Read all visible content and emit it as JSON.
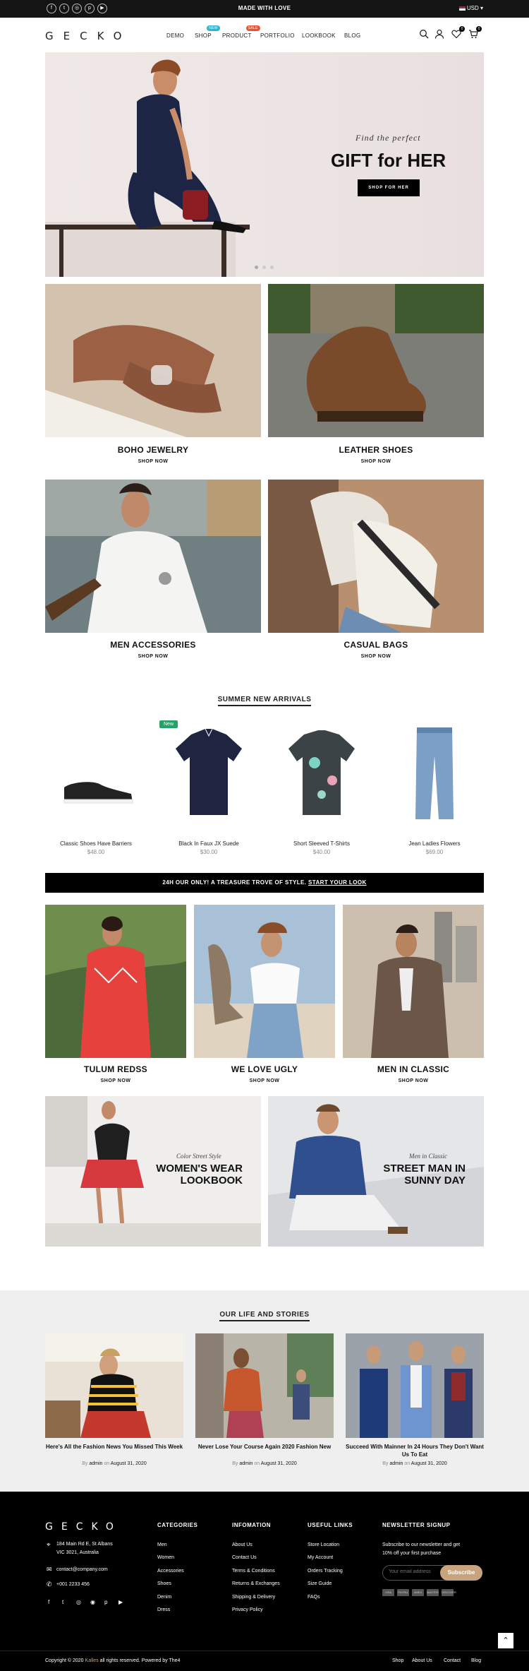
{
  "topbar": {
    "social_icons": [
      "facebook-icon",
      "twitter-icon",
      "instagram-icon",
      "pinterest-icon",
      "youtube-icon"
    ],
    "message": "MADE WITH LOVE",
    "currency": "USD"
  },
  "header": {
    "logo": "GECKO",
    "nav": [
      {
        "label": "DEMO"
      },
      {
        "label": "SHOP",
        "badge": "NEW",
        "badge_color": "#2fb5d2"
      },
      {
        "label": "PRODUCT",
        "badge": "SALE",
        "badge_color": "#e8563a"
      },
      {
        "label": "PORTFOLIO"
      },
      {
        "label": "LOOKBOOK"
      },
      {
        "label": "BLOG"
      }
    ],
    "wishlist_count": "0",
    "cart_count": "0"
  },
  "hero": {
    "subtitle": "Find the perfect",
    "title": "GIFT for HER",
    "button": "SHOP FOR HER",
    "slides": 3
  },
  "categories": [
    {
      "title": "BOHO JEWELRY",
      "link": "SHOP NOW"
    },
    {
      "title": "LEATHER SHOES",
      "link": "SHOP NOW"
    },
    {
      "title": "MEN ACCESSORIES",
      "link": "SHOP NOW"
    },
    {
      "title": "CASUAL BAGS",
      "link": "SHOP NOW"
    }
  ],
  "arrivals": {
    "title": "SUMMER NEW ARRIVALS",
    "products": [
      {
        "name": "Classic Shoes Have Barriers",
        "price": "$48.00"
      },
      {
        "name": "Black In Faux JX Suede",
        "price": "$30.00",
        "badge": "New"
      },
      {
        "name": "Short Sleeved T-Shirts",
        "price": "$40.00"
      },
      {
        "name": "Jean Ladies Flowers",
        "price": "$69.00"
      }
    ]
  },
  "promo": {
    "text": "24H OUR ONLY! A TREASURE TROVE OF STYLE.",
    "link": "START YOUR LOOK"
  },
  "collections": [
    {
      "title": "TULUM REDSS",
      "link": "SHOP NOW"
    },
    {
      "title": "WE LOVE UGLY",
      "link": "SHOP NOW"
    },
    {
      "title": "MEN IN CLASSIC",
      "link": "SHOP NOW"
    }
  ],
  "banners": [
    {
      "subtitle": "Color Street Style",
      "title_line1": "WOMEN'S WEAR",
      "title_line2": "LOOKBOOK"
    },
    {
      "subtitle": "Men in Classic",
      "title_line1": "STREET MAN IN",
      "title_line2": "SUNNY DAY"
    }
  ],
  "stories": {
    "title": "OUR LIFE AND STORIES",
    "posts": [
      {
        "title": "Here's All the Fashion News You Missed This Week",
        "by": "By",
        "author": "admin",
        "on": "on",
        "date": "August 31, 2020"
      },
      {
        "title": "Never Lose Your Course Again 2020 Fashion New",
        "by": "By",
        "author": "admin",
        "on": "on",
        "date": "August 31, 2020"
      },
      {
        "title": "Succeed With Mainner In 24 Hours They Don't Want Us To Eat",
        "by": "By",
        "author": "admin",
        "on": "on",
        "date": "August 31, 2020"
      }
    ]
  },
  "footer": {
    "logo": "GECKO",
    "address_line1": "184 Main Rd E, St Albans",
    "address_line2": "VIC 3021, Australia",
    "email": "contact@company.com",
    "phone": "+001 2233 456",
    "categories_title": "CATEGORIES",
    "categories": [
      "Men",
      "Women",
      "Accessories",
      "Shoes",
      "Denim",
      "Dress"
    ],
    "info_title": "INFOMATION",
    "info": [
      "About Us",
      "Contact Us",
      "Terms & Conditions",
      "Returns & Exchanges",
      "Shipping & Delivery",
      "Privacy Policy"
    ],
    "useful_title": "USEFUL LINKS",
    "useful": [
      "Store Location",
      "My Account",
      "Orders Tracking",
      "Size Guide",
      "FAQs"
    ],
    "newsletter_title": "NEWSLETTER SIGNUP",
    "newsletter_text1": "Subscribe to our newsletter and get",
    "newsletter_text2": "10% off your first purchase",
    "email_placeholder": "Your email address",
    "subscribe": "Subscribe",
    "payments": [
      "VISA",
      "PAYPAL",
      "AMEX",
      "MASTER",
      "DISCOVER"
    ],
    "copyright_pre": "Copyright © 2020",
    "copyright_brand": "Kalles",
    "copyright_post": "all rights reserved. Powered by The4",
    "bottom_links": [
      "Shop",
      "About Us",
      "Contact",
      "Blog"
    ]
  }
}
